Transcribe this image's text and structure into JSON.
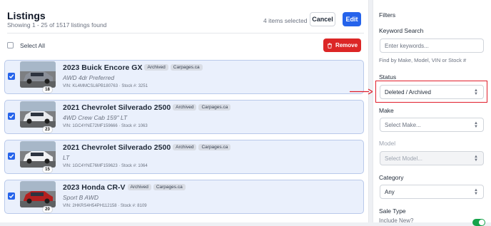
{
  "header": {
    "title": "Listings",
    "subtitle": "Showing 1 - 25 of 1517 listings found",
    "selected_count": "4 items selected",
    "cancel_label": "Cancel",
    "edit_label": "Edit"
  },
  "toolbar": {
    "select_all_label": "Select All",
    "remove_label": "Remove"
  },
  "listings": [
    {
      "title": "2023 Buick Encore GX",
      "status": "Archived",
      "source": "Carpages.ca",
      "trim": "AWD 4dr Preferred",
      "vin_line": "VIN: KL4MMCSL6PB180763 · Stock #: 3251",
      "photo_count": "18",
      "checked": true,
      "car_color": "#8a8f98"
    },
    {
      "title": "2021 Chevrolet Silverado 2500",
      "status": "Archived",
      "source": "Carpages.ca",
      "trim": "4WD Crew Cab 159\" LT",
      "vin_line": "VIN: 1GC4YNE72MF159666 · Stock #: 1063",
      "photo_count": "23",
      "checked": true,
      "car_color": "#e8eaee"
    },
    {
      "title": "2021 Chevrolet Silverado 2500",
      "status": "Archived",
      "source": "Carpages.ca",
      "trim": "LT",
      "vin_line": "VIN: 1GC4YNE76MF159623 · Stock #: 1064",
      "photo_count": "15",
      "checked": true,
      "car_color": "#f1f2f4"
    },
    {
      "title": "2023 Honda CR-V",
      "status": "Archived",
      "source": "Carpages.ca",
      "trim": "Sport B AWD",
      "vin_line": "VIN: 2HKRS4H54PH112158 · Stock #: 8109",
      "photo_count": "20",
      "checked": true,
      "car_color": "#b32020"
    }
  ],
  "filters": {
    "title": "Filters",
    "keyword_label": "Keyword Search",
    "keyword_placeholder": "Enter keywords...",
    "keyword_hint": "Find by Make, Model, VIN or Stock #",
    "status_label": "Status",
    "status_value": "Deleted / Archived",
    "make_label": "Make",
    "make_value": "Select Make...",
    "model_label": "Model",
    "model_value": "Select Model...",
    "category_label": "Category",
    "category_value": "Any",
    "sale_type_label": "Sale Type",
    "include_new_label": "Include New?"
  },
  "colors": {
    "accent": "#2563eb",
    "danger": "#dc2626",
    "highlight": "#e11d2a",
    "toggle_on": "#16a34a"
  }
}
